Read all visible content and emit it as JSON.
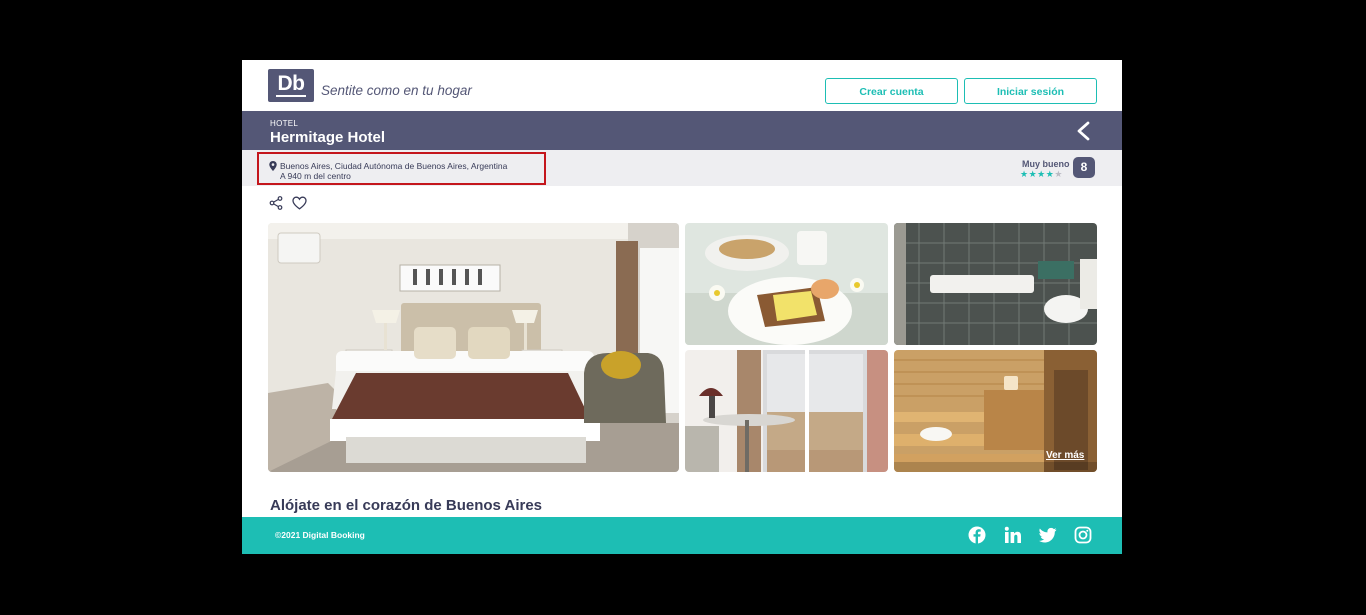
{
  "header": {
    "logo_text": "Db",
    "slogan": "Sentite como en tu hogar",
    "create_account_label": "Crear cuenta",
    "login_label": "Iniciar sesión"
  },
  "hotel": {
    "category": "HOTEL",
    "name": "Hermitage Hotel"
  },
  "location": {
    "address": "Buenos Aires, Ciudad Autónoma de Buenos Aires, Argentina",
    "distance": "A 940 m del centro"
  },
  "rating": {
    "label": "Muy bueno",
    "score": "8",
    "stars_filled": 4,
    "stars_total": 5
  },
  "gallery": {
    "see_more_label": "Ver más",
    "images": [
      "bedroom",
      "breakfast",
      "bathroom",
      "dining-area",
      "sauna"
    ]
  },
  "section_title": "Alójate en el corazón de Buenos Aires",
  "footer": {
    "copyright": "©2021 Digital Booking",
    "social": [
      "facebook-icon",
      "linkedin-icon",
      "twitter-icon",
      "instagram-icon"
    ]
  },
  "colors": {
    "primary": "#545776",
    "accent": "#1dbeb4",
    "highlight": "#c4161c"
  }
}
